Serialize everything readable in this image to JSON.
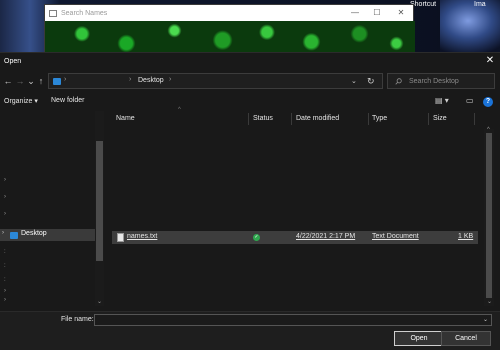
{
  "desktop": {
    "shortcut_label": "Shortcut",
    "image_label": "Ima"
  },
  "background_window": {
    "title": "Search Names",
    "minimize": "—",
    "maximize": "☐",
    "close": "✕"
  },
  "dialog": {
    "title": "Open",
    "close": "✕",
    "nav": {
      "back": "←",
      "forward": "→",
      "recent": "⌄",
      "up": "↑"
    },
    "address": {
      "sep1": "›",
      "sep2": "›",
      "sep3": "›",
      "crumb": "Desktop",
      "dropdown": "⌄",
      "refresh": "↻"
    },
    "search": {
      "placeholder": "Search Desktop"
    },
    "toolbar": {
      "organize": "Organize ▾",
      "new_folder": "New folder",
      "view": "▤ ▾",
      "pane": "▭",
      "help": "?"
    },
    "nav_pane": {
      "arrows": [
        "›",
        "›",
        "›"
      ],
      "desktop_label": "Desktop",
      "desktop_chevron": "›",
      "lower_marks": [
        ":",
        ":",
        ":",
        "›",
        "›"
      ],
      "scroll_down": "⌄"
    },
    "columns": {
      "name": "Name",
      "status": "Status",
      "date_modified": "Date modified",
      "type": "Type",
      "size": "Size"
    },
    "sort_caret": "^",
    "files": [
      {
        "name": "names.txt",
        "status": "✓",
        "date_modified": "4/22/2021 2:17 PM",
        "type": "Text Document",
        "size": "1 KB"
      }
    ],
    "file_name_label": "File name:",
    "file_name_value": "",
    "file_name_dropdown": "⌄",
    "open_button": "Open",
    "cancel_button": "Cancel",
    "scroll_up": "^",
    "scroll_down": "⌄"
  }
}
